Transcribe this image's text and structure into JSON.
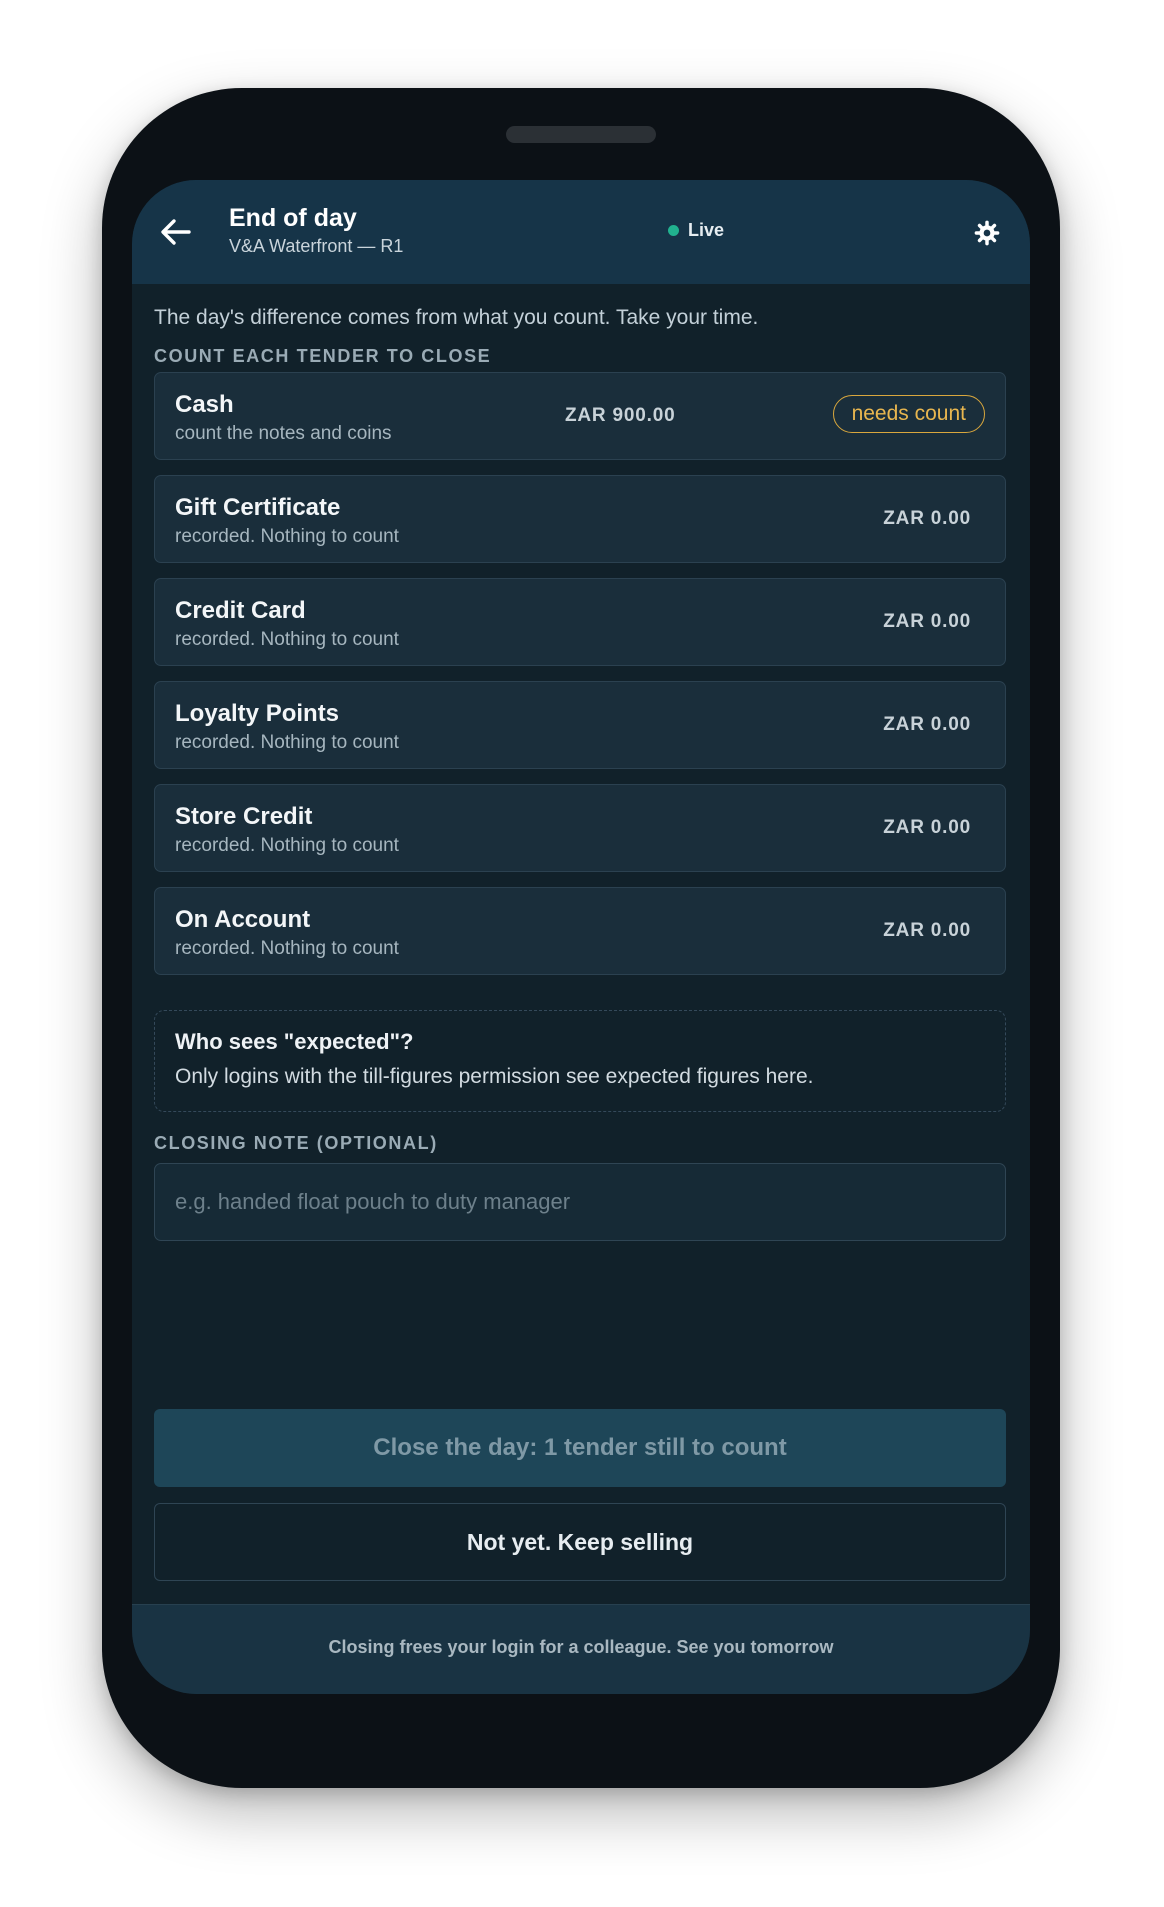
{
  "header": {
    "title": "End of day",
    "subtitle": "V&A Waterfront — R1",
    "status": "Live",
    "status_color": "#21b28f",
    "back_icon": "arrow-left-icon",
    "settings_icon": "gear-icon"
  },
  "intro_text": "The day's difference comes from what you count. Take your time.",
  "tenders_section_label": "COUNT EACH TENDER TO CLOSE",
  "tenders": [
    {
      "name": "Cash",
      "subtitle": "count the notes and coins",
      "amount": "ZAR 900.00",
      "badge": "needs count"
    },
    {
      "name": "Gift Certificate",
      "subtitle": "recorded. Nothing to count",
      "amount": "ZAR 0.00"
    },
    {
      "name": "Credit Card",
      "subtitle": "recorded. Nothing to count",
      "amount": "ZAR 0.00"
    },
    {
      "name": "Loyalty Points",
      "subtitle": "recorded. Nothing to count",
      "amount": "ZAR 0.00"
    },
    {
      "name": "Store Credit",
      "subtitle": "recorded. Nothing to count",
      "amount": "ZAR 0.00"
    },
    {
      "name": "On Account",
      "subtitle": "recorded. Nothing to count",
      "amount": "ZAR 0.00"
    }
  ],
  "info": {
    "title": "Who sees \"expected\"?",
    "text": "Only logins with the till-figures permission see expected figures here."
  },
  "closing_note": {
    "label": "CLOSING NOTE (OPTIONAL)",
    "placeholder": "e.g. handed float pouch to duty manager",
    "value": ""
  },
  "actions": {
    "close_label": "Close the day: 1 tender still to count",
    "keep_selling_label": "Not yet. Keep selling"
  },
  "footer_text": "Closing frees your login for a colleague. See you tomorrow",
  "colors": {
    "accent_badge": "#d9a73d",
    "header_bg": "#163448",
    "screen_bg": "#11212a"
  }
}
